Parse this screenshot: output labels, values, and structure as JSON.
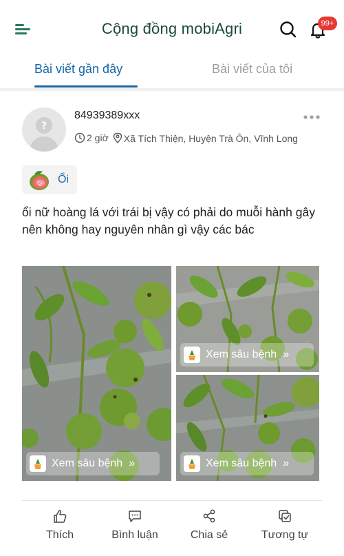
{
  "header": {
    "title": "Cộng đồng mobiAgri",
    "notification_count": "99+"
  },
  "tabs": {
    "recent": "Bài viết gần đây",
    "mine": "Bài viết của tôi"
  },
  "post": {
    "username": "84939389xxx",
    "time": "2 giờ",
    "location": "Xã Tích Thiện, Huyện Trà Ôn, Vĩnh Long",
    "crop": "Ổi",
    "text": "ổi nữ hoàng lá với trái bị vậy có phải do muỗi hành gây nên không hay nguyên nhân gì vậy các bác",
    "pest_button_label": "Xem sâu bệnh"
  },
  "actions": {
    "like": "Thích",
    "comment": "Bình luận",
    "share": "Chia sẻ",
    "similar": "Tương tự"
  },
  "colors": {
    "primary_blue": "#1667a8",
    "title_green": "#1c4b36",
    "badge_red": "#e53935",
    "fruit_green": "#6f9a2a"
  }
}
